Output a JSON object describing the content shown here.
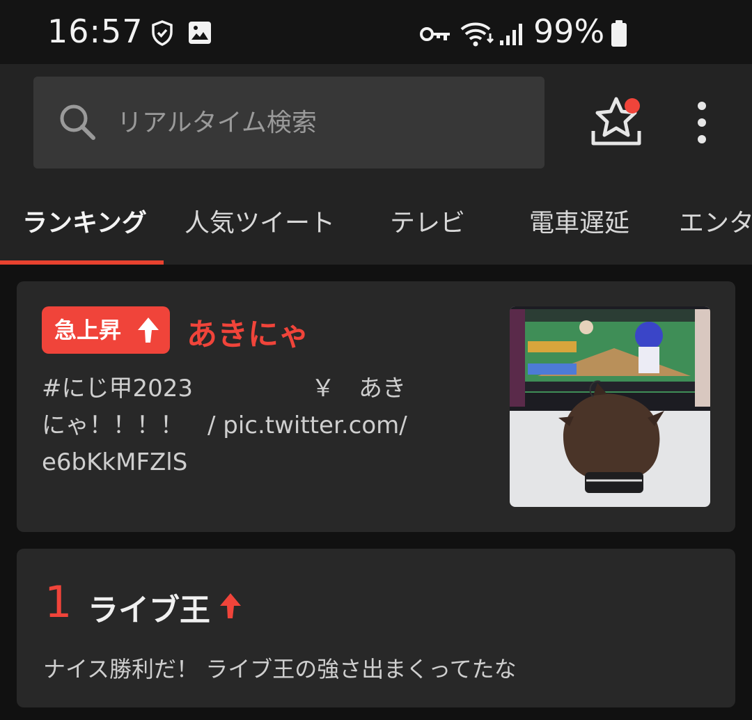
{
  "status_bar": {
    "time": "16:57",
    "battery": "99%",
    "icons": [
      "shield-check-icon",
      "image-icon",
      "vpn-key-icon",
      "wifi-icon",
      "signal-icon",
      "battery-icon"
    ]
  },
  "header": {
    "search": {
      "placeholder": "リアルタイム検索",
      "value": ""
    },
    "favorites_icon": "star-tray-icon",
    "notification_color": "#f0443a",
    "menu_icon": "more-vertical-icon"
  },
  "tabs": [
    {
      "label": "ランキング",
      "active": true
    },
    {
      "label": "人気ツイート",
      "active": false
    },
    {
      "label": "テレビ",
      "active": false
    },
    {
      "label": "電車遅延",
      "active": false
    },
    {
      "label": "エンタ",
      "active": false
    }
  ],
  "accent_color": "#e8422f",
  "trending_card": {
    "badge": "急上昇",
    "title": "あきにゃ",
    "text": "#にじ甲2023　　　　　￥　あき\nにゃ！！！！　/ pic.twitter.com/\ne6bKkMFZlS"
  },
  "ranking_card": {
    "rank": "1",
    "title": "ライブ王",
    "text": "ナイス勝利だ！ ライブ王の強さ出まくってたな"
  }
}
